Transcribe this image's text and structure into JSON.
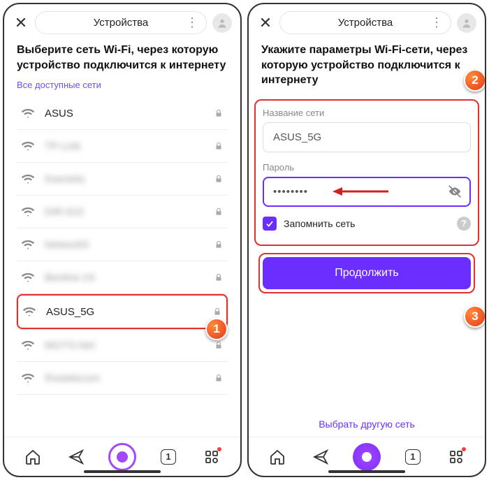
{
  "header": {
    "title": "Устройства"
  },
  "screen1": {
    "heading": "Выберите сеть Wi-Fi, через которую устройство подключится к интернету",
    "subheading": "Все доступные сети",
    "networks": [
      {
        "name": "ASUS",
        "blurred": false
      },
      {
        "name": "TP-Link",
        "blurred": true
      },
      {
        "name": "Keenetic",
        "blurred": true
      },
      {
        "name": "DIR-615",
        "blurred": true
      },
      {
        "name": "Network5",
        "blurred": true
      },
      {
        "name": "Beeline-24",
        "blurred": true
      },
      {
        "name": "ASUS_5G",
        "blurred": false
      },
      {
        "name": "MGTS-Net",
        "blurred": true
      },
      {
        "name": "Rostelecom",
        "blurred": true
      }
    ],
    "callout": "1"
  },
  "screen2": {
    "heading": "Укажите параметры Wi-Fi-сети, через которую устройство подключится к интернету",
    "network_label": "Название сети",
    "network_value": "ASUS_5G",
    "password_label": "Пароль",
    "password_value": "••••••••",
    "remember_label": "Запомнить сеть",
    "continue_label": "Продолжить",
    "other_network": "Выбрать другую сеть",
    "callout_form": "2",
    "callout_btn": "3"
  },
  "nav": {
    "tab_count": "1"
  }
}
